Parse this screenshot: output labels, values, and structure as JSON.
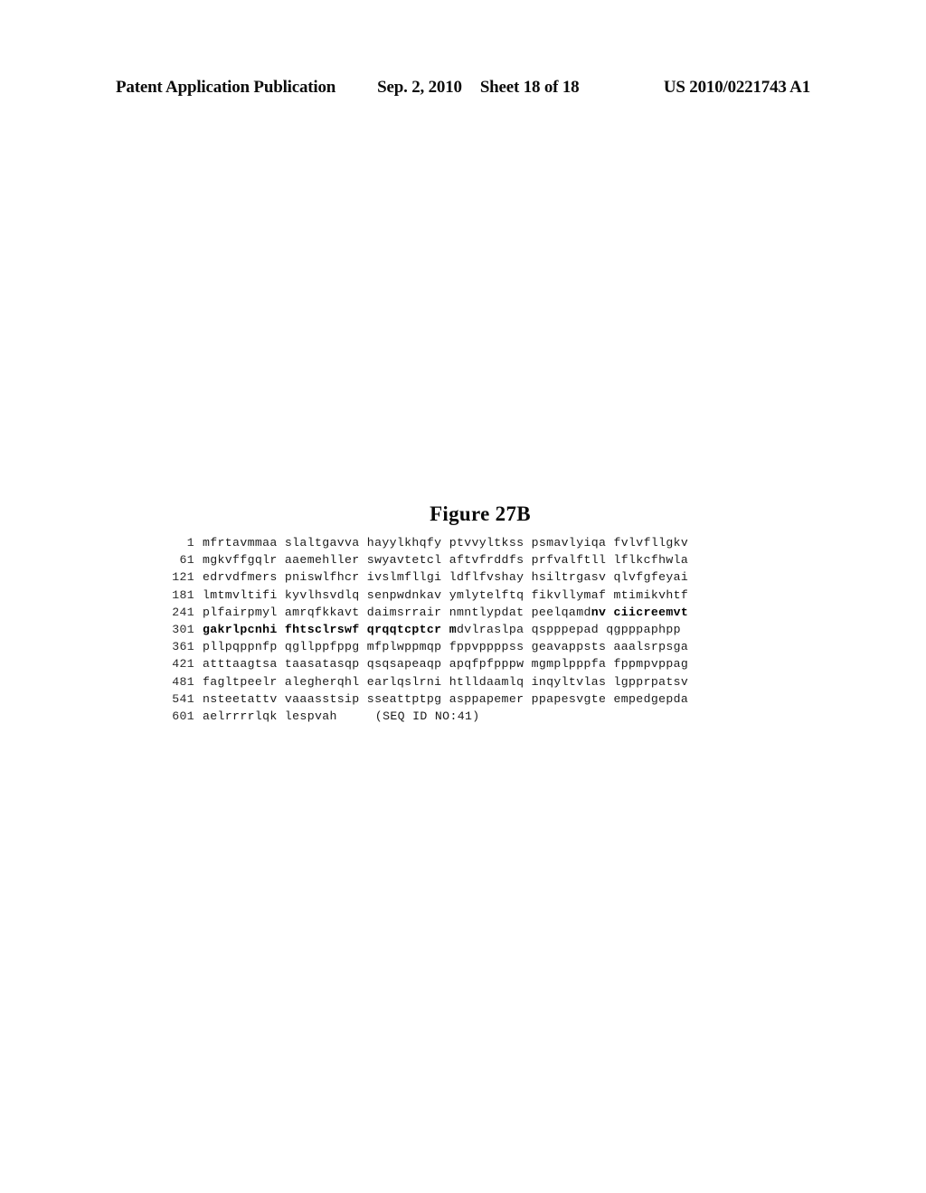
{
  "header": {
    "publication": "Patent Application Publication",
    "date": "Sep. 2, 2010",
    "sheet": "Sheet 18 of 18",
    "document_number": "US 2010/0221743 A1"
  },
  "figure": {
    "title": "Figure 27B",
    "sequence_note": "(SEQ ID NO:41)",
    "rows": [
      {
        "index": "1",
        "plain_before": "mfrtavmmaa slaltgavva hayylkhqfy ptvvyltkss psmavlyiqa fvlvfllgkv",
        "bold": "",
        "plain_after": ""
      },
      {
        "index": "61",
        "plain_before": "mgkvffgqlr aaemehller swyavtetcl aftvfrddfs prfvalftll lflkcfhwla",
        "bold": "",
        "plain_after": ""
      },
      {
        "index": "121",
        "plain_before": "edrvdfmers pniswlfhcr ivslmfllgi ldflfvshay hsiltrgasv qlvfgfeyai",
        "bold": "",
        "plain_after": ""
      },
      {
        "index": "181",
        "plain_before": "lmtmvltifi kyvlhsvdlq senpwdnkav ymlytelftq fikvllymaf mtimikvhtf",
        "bold": "",
        "plain_after": ""
      },
      {
        "index": "241",
        "plain_before": "plfairpmyl amrqfkkavt daimsrrair nmntlypdat peelqamd",
        "bold": "nv ciicreemvt",
        "plain_after": ""
      },
      {
        "index": "301",
        "plain_before": "",
        "bold": "gakrlpcnhi fhtsclrswf qrqqtcptcr m",
        "plain_after": "dvlraslpa qspppepad qgpppaphpp"
      },
      {
        "index": "361",
        "plain_before": "pllpqppnfp qgllppfppg mfplwppmqp fppvppppss geavappsts aaalsrpsga",
        "bold": "",
        "plain_after": ""
      },
      {
        "index": "421",
        "plain_before": "atttaagtsa taasatasqp qsqsapeaqp apqfpfpppw mgmplpppfa fppmpvppag",
        "bold": "",
        "plain_after": ""
      },
      {
        "index": "481",
        "plain_before": "fagltpeelr alegherqhl earlqslrni htlldaamlq inqyltvlas lgpprpatsv",
        "bold": "",
        "plain_after": ""
      },
      {
        "index": "541",
        "plain_before": "nsteetattv vaaasstsip sseattptpg asppapemer ppapesvgte empedgepda",
        "bold": "",
        "plain_after": ""
      },
      {
        "index": "601",
        "plain_before": "aelrrrrlqk lespvah",
        "bold": "",
        "plain_after": ""
      }
    ]
  }
}
